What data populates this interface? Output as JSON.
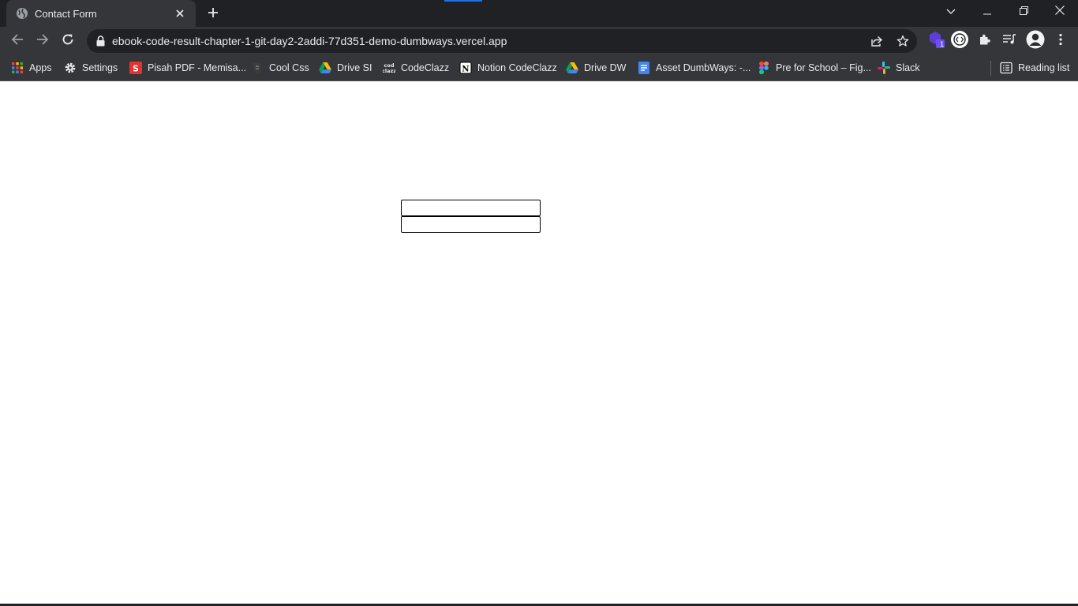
{
  "browser": {
    "tab_title": "Contact Form",
    "url": "ebook-code-result-chapter-1-git-day2-2addi-77d351-demo-dumbways.vercel.app",
    "extension_badge": "1"
  },
  "bookmarks": [
    {
      "label": "Apps",
      "icon": "apps-grid-icon"
    },
    {
      "label": "Settings",
      "icon": "gear-icon"
    },
    {
      "label": "Pisah PDF - Memisa...",
      "icon": "s-logo-icon"
    },
    {
      "label": "Cool Css",
      "icon": "css-logo-icon"
    },
    {
      "label": "Drive SI",
      "icon": "google-drive-icon"
    },
    {
      "label": "CodeClazz",
      "icon": "codeclazz-logo-icon"
    },
    {
      "label": "Notion CodeClazz",
      "icon": "notion-icon"
    },
    {
      "label": "Drive DW",
      "icon": "google-drive-icon"
    },
    {
      "label": "Asset DumbWays: -...",
      "icon": "google-docs-icon"
    },
    {
      "label": "Pre for School – Fig...",
      "icon": "figma-icon"
    },
    {
      "label": "Slack",
      "icon": "slack-icon"
    }
  ],
  "reading_list": {
    "label": "Reading list",
    "icon": "reading-list-icon"
  },
  "form": {
    "field1_value": "",
    "field1_placeholder": "",
    "field2_value": "",
    "field2_placeholder": ""
  },
  "colors": {
    "titlebar": "#202124",
    "toolbar": "#35363a",
    "text": "#e8eaed",
    "accent": "#1a73e8"
  }
}
